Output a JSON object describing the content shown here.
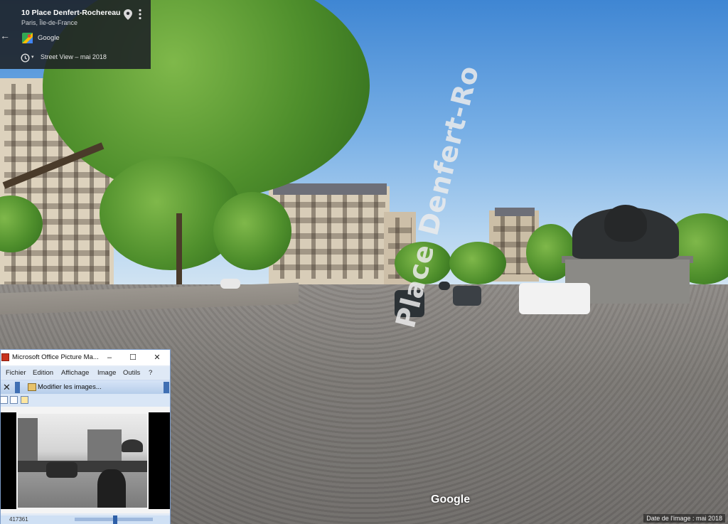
{
  "info_card": {
    "title": "10 Place Denfert-Rochereau",
    "subtitle": "Paris, Île-de-France",
    "provider": "Google",
    "date_label": "Street View – mai 2018"
  },
  "street_view": {
    "road_marking": "Place Denfert-Ro",
    "logo": "Google",
    "image_date": "Date de l'image : mai 2018"
  },
  "picture_manager": {
    "title": "Microsoft Office Picture Ma...",
    "window_buttons": {
      "minimize": "–",
      "maximize": "☐",
      "close": "✕"
    },
    "menus": [
      "Fichier",
      "Edition",
      "Affichage",
      "Image",
      "Outils",
      "?"
    ],
    "toolbar": {
      "close_label": "✕",
      "edit_label": "Modifier les images..."
    },
    "status": {
      "left_text": "417361"
    }
  },
  "colors": {
    "card_bg": "#1e2126",
    "window_accent": "#3f6fb3",
    "app_icon": "#c8331e"
  }
}
